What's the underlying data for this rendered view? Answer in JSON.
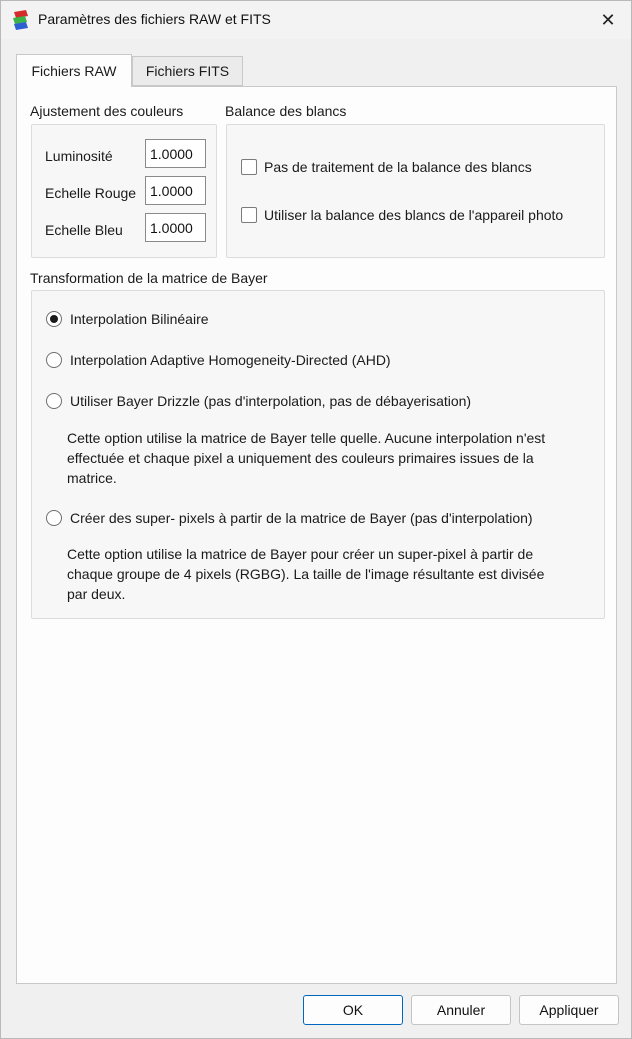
{
  "window": {
    "title": "Paramètres des fichiers RAW et FITS",
    "close_glyph": "✕"
  },
  "tabs": [
    {
      "label": "Fichiers RAW",
      "active": true
    },
    {
      "label": "Fichiers FITS",
      "active": false
    }
  ],
  "color_adjust": {
    "title": "Ajustement des couleurs",
    "fields": [
      {
        "label": "Luminosité",
        "value": "1.0000"
      },
      {
        "label": "Echelle Rouge",
        "value": "1.0000"
      },
      {
        "label": "Echelle Bleu",
        "value": "1.0000"
      }
    ]
  },
  "white_balance": {
    "title": "Balance des blancs",
    "options": [
      {
        "label": "Pas de traitement de la balance des blancs",
        "checked": false
      },
      {
        "label": "Utiliser la balance des blancs de l'appareil photo",
        "checked": false
      }
    ]
  },
  "bayer": {
    "title": "Transformation de la matrice de Bayer",
    "options": [
      {
        "label": "Interpolation Bilinéaire",
        "selected": true
      },
      {
        "label": "Interpolation Adaptive Homogeneity-Directed (AHD)",
        "selected": false
      },
      {
        "label": "Utiliser Bayer Drizzle (pas d'interpolation, pas de débayerisation)",
        "selected": false,
        "description_lines": [
          "Cette option utilise la matrice de Bayer telle quelle. Aucune interpolation n'est",
          "effectuée et chaque pixel a uniquement des couleurs primaires issues de la",
          "matrice."
        ]
      },
      {
        "label": "Créer des super- pixels à partir de la matrice de Bayer (pas d'interpolation)",
        "selected": false,
        "description_lines": [
          "Cette option utilise la matrice de Bayer pour créer un super-pixel à partir de",
          "chaque groupe de 4 pixels (RGBG). La taille de l'image résultante est divisée",
          "par deux."
        ]
      }
    ]
  },
  "buttons": {
    "ok": "OK",
    "cancel": "Annuler",
    "apply": "Appliquer"
  },
  "icons": {
    "app": "raw-fits-app-icon",
    "close": "close-icon"
  }
}
